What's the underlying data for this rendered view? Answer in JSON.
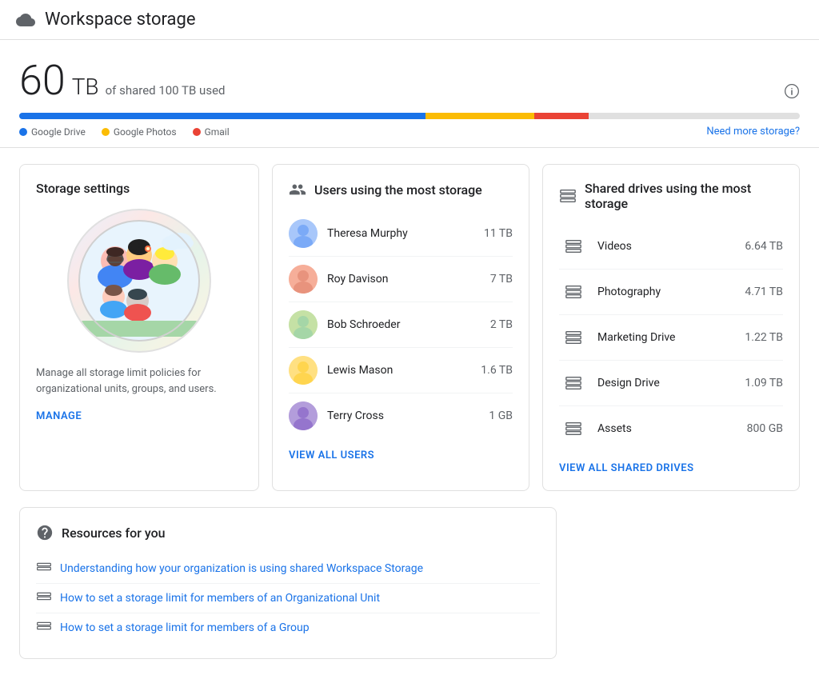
{
  "header": {
    "title": "Workspace storage",
    "icon": "cloud-icon"
  },
  "storage": {
    "size_number": "60",
    "size_unit": "TB",
    "description": "of shared 100 TB used",
    "info_label": "Need more storage?",
    "legend": {
      "drive_label": "Google Drive",
      "photos_label": "Google Photos",
      "gmail_label": "Gmail"
    },
    "progress": {
      "drive_percent": 52,
      "photos_percent": 14,
      "gmail_percent": 7
    }
  },
  "storage_settings": {
    "title": "Storage settings",
    "description": "Manage all storage limit policies for organizational units, groups, and users.",
    "manage_label": "MANAGE"
  },
  "users": {
    "title": "Users using the most storage",
    "view_all_label": "VIEW ALL USERS",
    "items": [
      {
        "name": "Theresa Murphy",
        "storage": "11 TB",
        "avatar_class": "avatar-theresa"
      },
      {
        "name": "Roy Davison",
        "storage": "7 TB",
        "avatar_class": "avatar-roy"
      },
      {
        "name": "Bob Schroeder",
        "storage": "2 TB",
        "avatar_class": "avatar-bob"
      },
      {
        "name": "Lewis Mason",
        "storage": "1.6 TB",
        "avatar_class": "avatar-lewis"
      },
      {
        "name": "Terry Cross",
        "storage": "1 GB",
        "avatar_class": "avatar-terry"
      }
    ]
  },
  "shared_drives": {
    "title": "Shared drives using the most storage",
    "view_all_label": "VIEW ALL SHARED DRIVES",
    "items": [
      {
        "name": "Videos",
        "storage": "6.64 TB"
      },
      {
        "name": "Photography",
        "storage": "4.71 TB"
      },
      {
        "name": "Marketing Drive",
        "storage": "1.22 TB"
      },
      {
        "name": "Design Drive",
        "storage": "1.09 TB"
      },
      {
        "name": "Assets",
        "storage": "800 GB"
      }
    ]
  },
  "resources": {
    "title": "Resources for you",
    "items": [
      {
        "label": "Understanding how your organization is using shared Workspace Storage"
      },
      {
        "label": "How to set a storage limit for members of an Organizational Unit"
      },
      {
        "label": "How to set a storage limit for members of a Group"
      }
    ]
  }
}
